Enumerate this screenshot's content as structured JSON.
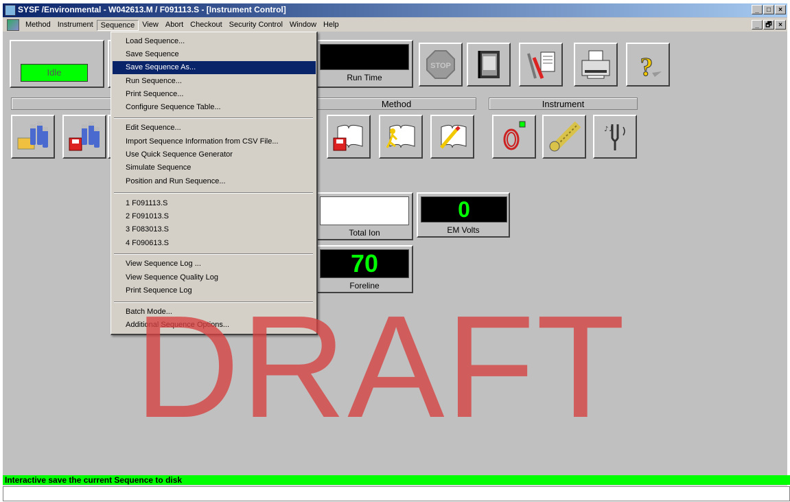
{
  "window": {
    "title": "SYSF /Environmental - W042613.M / F091113.S - [Instrument Control]",
    "min_glyph": "_",
    "max_glyph": "□",
    "close_glyph": "×",
    "restore_glyph": "🗗"
  },
  "menubar": {
    "items": [
      "Method",
      "Instrument",
      "Sequence",
      "View",
      "Abort",
      "Checkout",
      "Security Control",
      "Window",
      "Help"
    ],
    "active": "Sequence"
  },
  "status": {
    "state": "Idle"
  },
  "displays": {
    "run_time_label": "Run Time",
    "total_ion_label": "Total Ion",
    "em_volts_value": "0",
    "em_volts_label": "EM Volts",
    "foreline_value": "70",
    "foreline_label": "Foreline"
  },
  "sections": {
    "method": "Method",
    "instrument": "Instrument"
  },
  "sequence_menu": {
    "items": [
      "Load Sequence...",
      "Save Sequence",
      "Save Sequence As...",
      "Run Sequence...",
      "Print Sequence...",
      "Configure Sequence Table...",
      "Edit Sequence...",
      "Import Sequence Information from CSV File...",
      "Use Quick Sequence Generator",
      "Simulate Sequence",
      "Position and Run Sequence...",
      "1 F091113.S",
      "2 F091013.S",
      "3 F083013.S",
      "4 F090613.S",
      "View Sequence Log ...",
      "View Sequence Quality Log",
      "Print Sequence Log",
      "Batch Mode...",
      "Additional Sequence Options..."
    ],
    "selected": "Save Sequence As..."
  },
  "watermark": "DRAFT",
  "statusbar": {
    "text": "Interactive save the current Sequence to disk"
  },
  "colors": {
    "accent_green": "#00ff00",
    "title_blue": "#0a246a",
    "stop_gray": "#9a9a9a",
    "watermark": "#d64040"
  },
  "icons": [
    "load-sequence-icon",
    "save-sequence-icon",
    "load-method-icon",
    "save-method-icon",
    "run-method-icon",
    "edit-method-icon",
    "inlet-icon",
    "source-icon",
    "tune-icon",
    "stop-icon",
    "notebook-icon",
    "tools-icon",
    "printer-icon",
    "help-icon"
  ]
}
